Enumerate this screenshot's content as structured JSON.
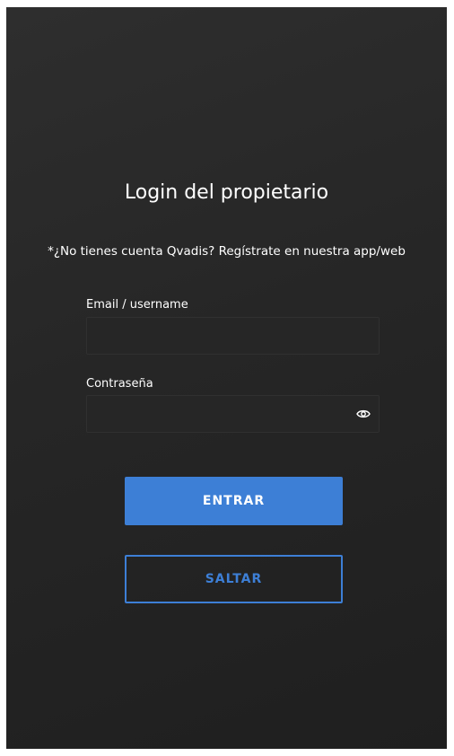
{
  "login": {
    "title": "Login del propietario",
    "subtitle": "*¿No tienes cuenta Qvadis? Regístrate en nuestra app/web"
  },
  "form": {
    "email_label": "Email / username",
    "email_value": "",
    "password_label": "Contraseña",
    "password_value": "",
    "password_toggle_icon": "eye-icon"
  },
  "buttons": {
    "enter_label": "ENTRAR",
    "skip_label": "SALTAR"
  },
  "colors": {
    "background": "#262626",
    "accent": "#3d7fd6",
    "text": "#ffffff"
  }
}
